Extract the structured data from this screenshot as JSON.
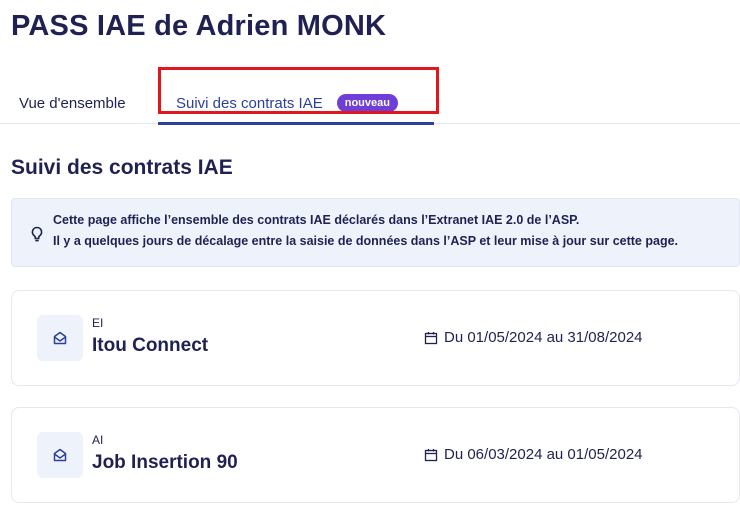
{
  "page": {
    "title": "PASS IAE de Adrien MONK"
  },
  "tabs": [
    {
      "label": "Vue d'ensemble",
      "active": false
    },
    {
      "label": "Suivi des contrats IAE",
      "active": true,
      "badge": "nouveau"
    }
  ],
  "section": {
    "title": "Suivi des contrats IAE"
  },
  "info": {
    "icon": "lightbulb-icon",
    "line1": "Cette page affiche l’ensemble des contrats IAE déclarés dans l’Extranet IAE 2.0 de l’ASP.",
    "line2": "Il y a quelques jours de décalage entre la saisie de données dans l’ASP et leur mise à jour sur cette page."
  },
  "contracts": [
    {
      "type": "EI",
      "name": "Itou Connect",
      "dates": "Du 01/05/2024 au 31/08/2024",
      "icon": "building-icon"
    },
    {
      "type": "AI",
      "name": "Job Insertion 90",
      "dates": "Du 06/03/2024 au 01/05/2024",
      "icon": "building-icon"
    }
  ],
  "colors": {
    "title": "#1f2153",
    "active_tab": "#2b3f9c",
    "badge": "#6f3ed8",
    "highlight": "#e0171c",
    "info_bg": "#eef3fb"
  }
}
